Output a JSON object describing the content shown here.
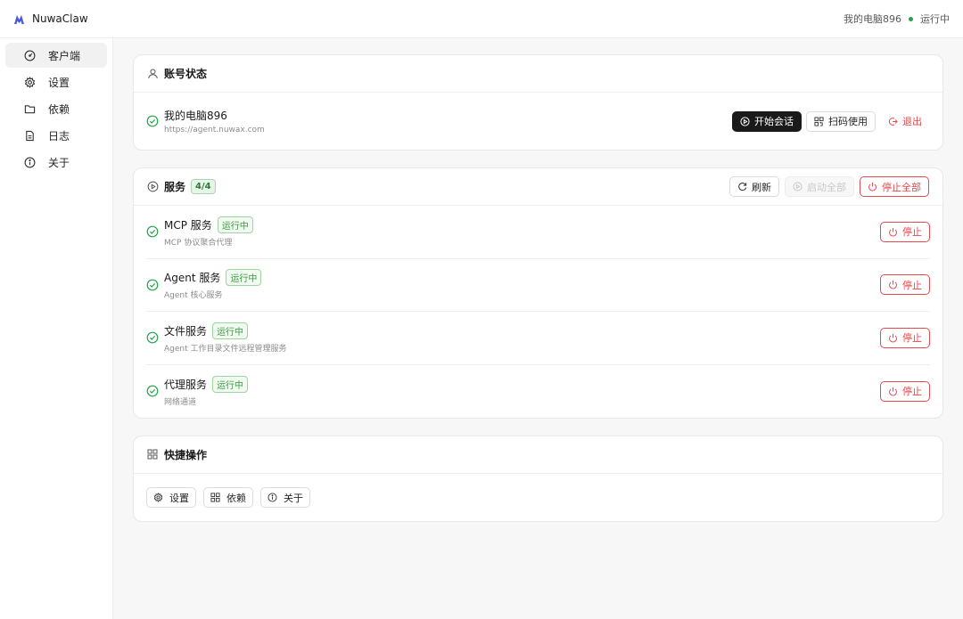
{
  "app": {
    "name": "NuwaClaw"
  },
  "topbar": {
    "device_name": "我的电脑896",
    "status_text": "运行中",
    "status_color": "#22a34a"
  },
  "sidebar": {
    "items": [
      {
        "label": "客户端",
        "icon": "dashboard-icon",
        "active": true
      },
      {
        "label": "设置",
        "icon": "gear-icon"
      },
      {
        "label": "依赖",
        "icon": "folder-icon"
      },
      {
        "label": "日志",
        "icon": "file-text-icon"
      },
      {
        "label": "关于",
        "icon": "info-icon"
      }
    ]
  },
  "account": {
    "title": "账号状态",
    "device_name": "我的电脑896",
    "url": "https://agent.nuwax.com",
    "start_label": "开始会话",
    "scan_label": "扫码使用",
    "logout_label": "退出"
  },
  "services": {
    "title": "服务",
    "count": "4/4",
    "refresh_label": "刷新",
    "start_all_label": "启动全部",
    "stop_all_label": "停止全部",
    "items": [
      {
        "name": "MCP 服务",
        "status": "运行中",
        "desc": "MCP 协议聚合代理",
        "stop_label": "停止"
      },
      {
        "name": "Agent 服务",
        "status": "运行中",
        "desc": "Agent 核心服务",
        "stop_label": "停止"
      },
      {
        "name": "文件服务",
        "status": "运行中",
        "desc": "Agent 工作目录文件远程管理服务",
        "stop_label": "停止"
      },
      {
        "name": "代理服务",
        "status": "运行中",
        "desc": "网络通道",
        "stop_label": "停止"
      }
    ]
  },
  "quick": {
    "title": "快捷操作",
    "settings_label": "设置",
    "deps_label": "依赖",
    "about_label": "关于"
  },
  "colors": {
    "accent_dark": "#1a1a1a",
    "danger": "#e5484d",
    "success": "#22a34a",
    "brand": "#4a5bd9"
  }
}
